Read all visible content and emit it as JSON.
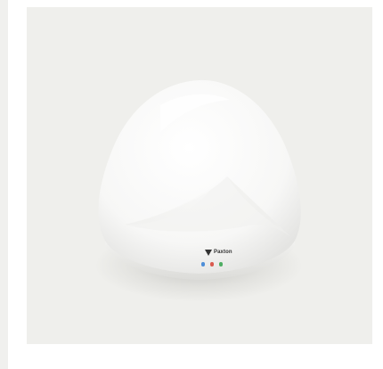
{
  "product": {
    "brand_text": "Paxton",
    "leds": [
      {
        "name": "blue",
        "color": "#4f8fd8"
      },
      {
        "name": "red",
        "color": "#d95b4f"
      },
      {
        "name": "green",
        "color": "#4fae63"
      }
    ]
  },
  "colors": {
    "background": "#efefec",
    "device": "#fafafa"
  }
}
